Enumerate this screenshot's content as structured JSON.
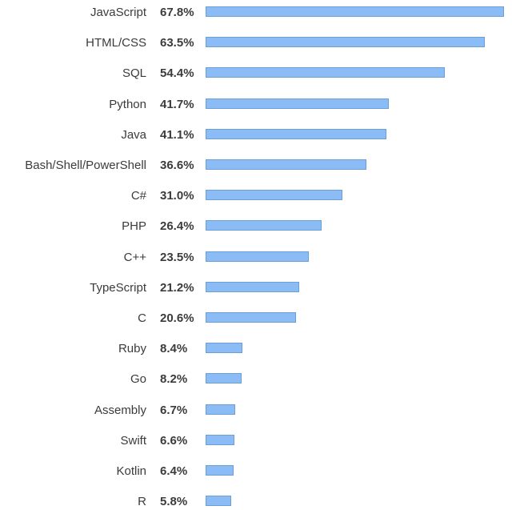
{
  "chart_data": {
    "type": "bar",
    "orientation": "horizontal",
    "title": "",
    "xlabel": "",
    "ylabel": "",
    "xlim": [
      0,
      67.8
    ],
    "grid": false,
    "bar_color": "#8cbcf6",
    "bar_border_color": "#6a9fd8",
    "categories": [
      "JavaScript",
      "HTML/CSS",
      "SQL",
      "Python",
      "Java",
      "Bash/Shell/PowerShell",
      "C#",
      "PHP",
      "C++",
      "TypeScript",
      "C",
      "Ruby",
      "Go",
      "Assembly",
      "Swift",
      "Kotlin",
      "R"
    ],
    "values": [
      67.8,
      63.5,
      54.4,
      41.7,
      41.1,
      36.6,
      31.0,
      26.4,
      23.5,
      21.2,
      20.6,
      8.4,
      8.2,
      6.7,
      6.6,
      6.4,
      5.8
    ],
    "value_labels": [
      "67.8%",
      "63.5%",
      "54.4%",
      "41.7%",
      "41.1%",
      "36.6%",
      "31.0%",
      "26.4%",
      "23.5%",
      "21.2%",
      "20.6%",
      "8.4%",
      "8.2%",
      "6.7%",
      "6.6%",
      "6.4%",
      "5.8%"
    ]
  }
}
